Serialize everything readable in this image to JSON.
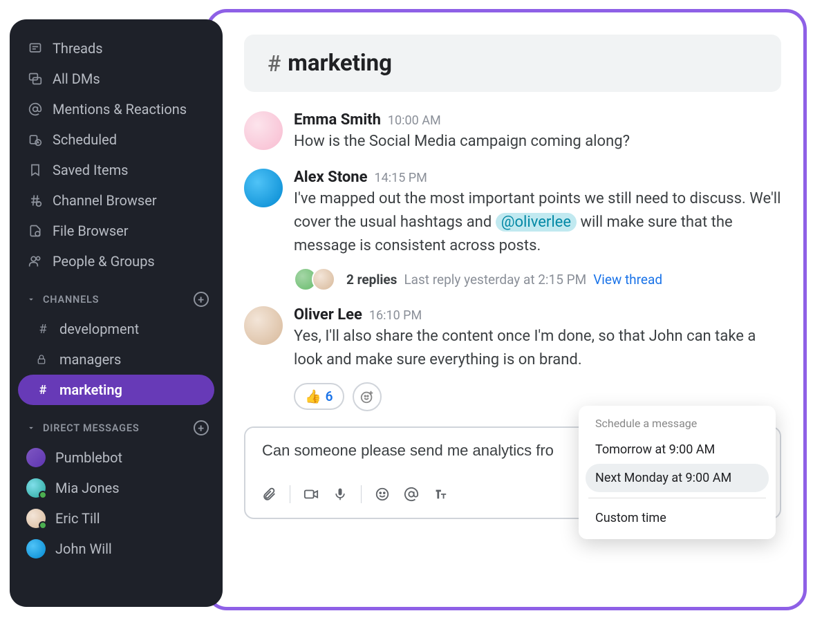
{
  "sidebar": {
    "nav": [
      {
        "label": "Threads",
        "icon": "threads-icon"
      },
      {
        "label": "All DMs",
        "icon": "dms-icon"
      },
      {
        "label": "Mentions & Reactions",
        "icon": "mention-icon"
      },
      {
        "label": "Scheduled",
        "icon": "schedule-icon"
      },
      {
        "label": "Saved Items",
        "icon": "bookmark-icon"
      },
      {
        "label": "Channel Browser",
        "icon": "channel-browser-icon"
      },
      {
        "label": "File Browser",
        "icon": "file-browser-icon"
      },
      {
        "label": "People & Groups",
        "icon": "people-icon"
      }
    ],
    "channels_header": "CHANNELS",
    "channels": [
      {
        "name": "development",
        "type": "hash",
        "active": false
      },
      {
        "name": "managers",
        "type": "lock",
        "active": false
      },
      {
        "name": "marketing",
        "type": "hash",
        "active": true
      }
    ],
    "dms_header": "DIRECT MESSAGES",
    "dms": [
      {
        "name": "Pumblebot",
        "presence": false,
        "avatar": "bot"
      },
      {
        "name": "Mia Jones",
        "presence": true,
        "avatar": "teal"
      },
      {
        "name": "Eric Till",
        "presence": true,
        "avatar": "brown"
      },
      {
        "name": "John Will",
        "presence": false,
        "avatar": "blue"
      }
    ]
  },
  "channel": {
    "name": "marketing"
  },
  "messages": [
    {
      "author": "Emma Smith",
      "time": "10:00 AM",
      "text": " How is the Social Media campaign coming along?",
      "avatar": "pink"
    },
    {
      "author": "Alex Stone",
      "time": "14:15 PM",
      "text_before": "I've mapped out the most important points we still need to discuss.  We'll cover the usual hashtags and ",
      "mention": "@oliverlee",
      "text_after": " will make sure that the message is consistent across posts.",
      "avatar": "blue",
      "thread": {
        "replies_label": "2 replies",
        "meta": "Last reply yesterday at 2:15 PM",
        "link": "View thread"
      }
    },
    {
      "author": "Oliver Lee",
      "time": "16:10 PM",
      "text": "Yes, I'll also share the content once I'm done, so that John can take a look and make sure everything is on brand.",
      "avatar": "brown",
      "reaction": {
        "emoji": "👍",
        "count": 6
      }
    }
  ],
  "composer": {
    "draft": "Can someone please send me analytics fro"
  },
  "schedule": {
    "title": "Schedule a message",
    "options": [
      {
        "label": "Tomorrow at 9:00 AM",
        "selected": false
      },
      {
        "label": "Next Monday at 9:00 AM",
        "selected": true
      }
    ],
    "custom": "Custom time"
  }
}
